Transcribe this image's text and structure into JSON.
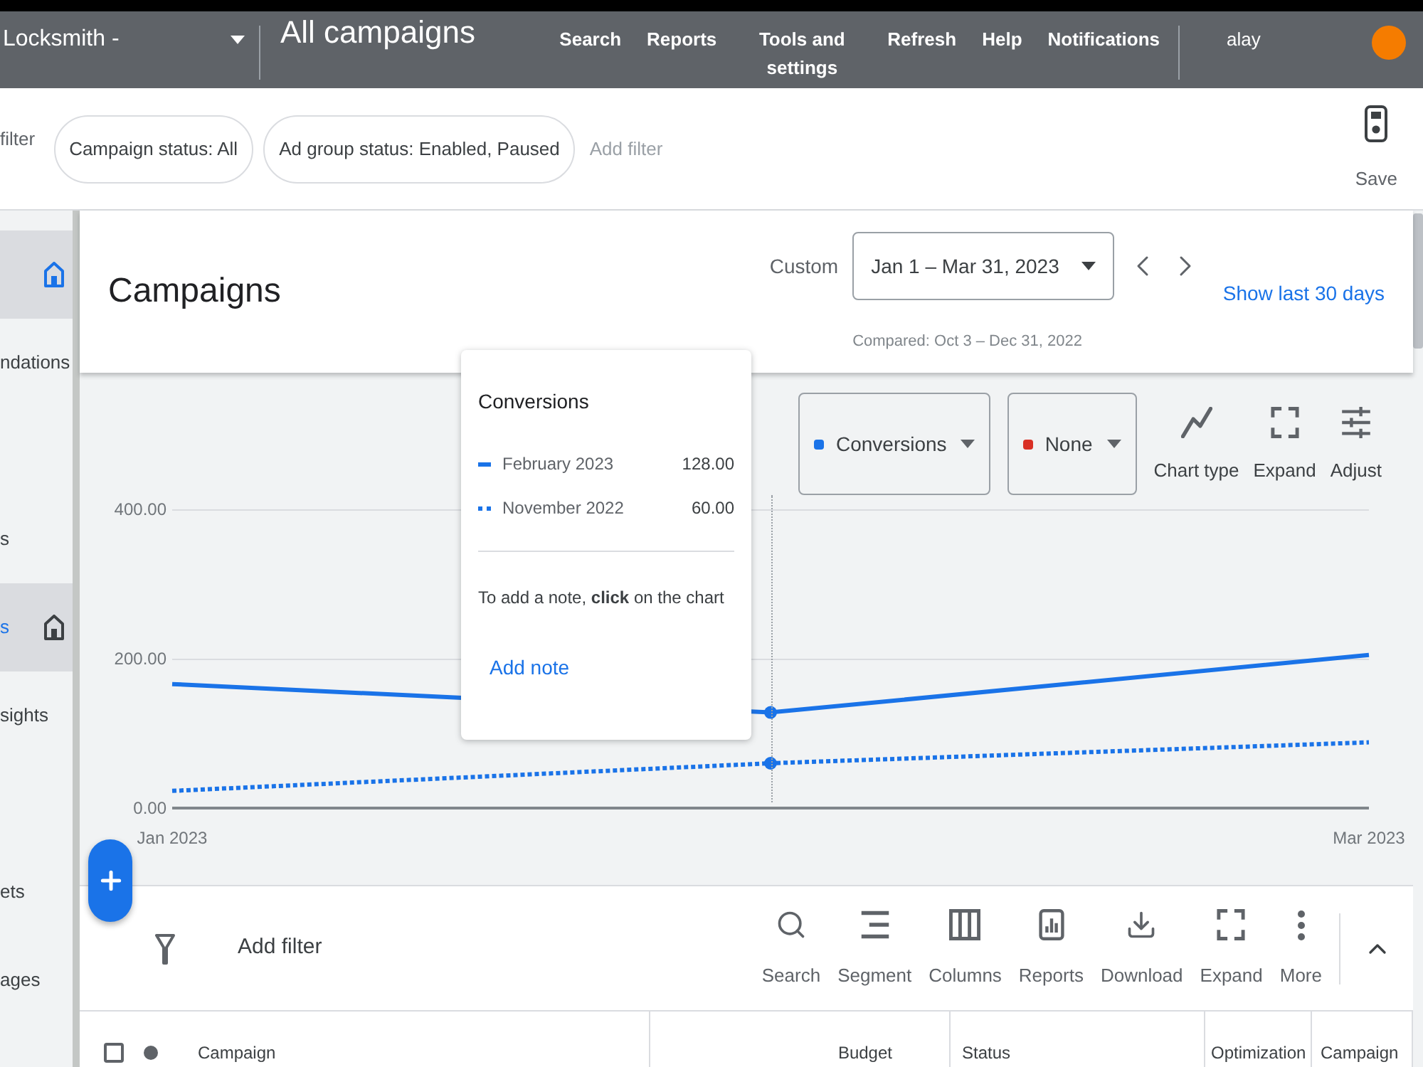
{
  "header": {
    "account": "Locksmith -",
    "page_title": "All campaigns",
    "nav": [
      "Search",
      "Reports",
      "Tools and settings",
      "Refresh",
      "Help",
      "Notifications"
    ],
    "user": "alay"
  },
  "filter_bar": {
    "leading_text": "filter",
    "chips": [
      "Campaign status: All",
      "Ad group status: Enabled, Paused"
    ],
    "add_filter": "Add filter",
    "save": "Save"
  },
  "sidebar": {
    "sections": [
      {
        "items": [
          {
            "selected": true,
            "home_icon": {
              "active": true
            }
          },
          {
            "label": "ndations",
            "selected": false
          }
        ]
      },
      {
        "items": [
          {
            "label": "s",
            "selected": false
          },
          {
            "label": "s",
            "selected": true,
            "home_icon": {
              "active": false
            }
          },
          {
            "label": "sights",
            "selected": false
          }
        ]
      },
      {
        "items": [
          {
            "label": "ets",
            "selected": false
          },
          {
            "label": "ages",
            "selected": false
          }
        ]
      }
    ]
  },
  "campaigns_header": {
    "title": "Campaigns",
    "range_label": "Custom",
    "date_range": "Jan 1 – Mar 31, 2023",
    "compared": "Compared: Oct 3 – Dec 31, 2022",
    "show_last": "Show last 30 days"
  },
  "chart": {
    "metrics": [
      {
        "label": "Conversions",
        "color": "#1a73e8"
      },
      {
        "label": "None",
        "color": "#d93025"
      }
    ],
    "tools": [
      {
        "label": "Chart type",
        "kind": "linechart"
      },
      {
        "label": "Expand",
        "kind": "expand"
      },
      {
        "label": "Adjust",
        "kind": "adjust"
      }
    ],
    "chart_data": {
      "type": "line",
      "categories": [
        "Jan 2023",
        null,
        "Mar 2023"
      ],
      "ylim": [
        0,
        400
      ],
      "yticks": [
        {
          "value": 0,
          "label": "0.00"
        },
        {
          "value": 200,
          "label": "200.00"
        },
        {
          "value": 400,
          "label": "400.00"
        }
      ],
      "series": [
        {
          "color": "#1a73e8",
          "line_style": "solid",
          "values": [
            166,
            128,
            205
          ]
        },
        {
          "color": "#1a73e8",
          "line_style": "dotted",
          "values": [
            23,
            60,
            88
          ]
        }
      ]
    },
    "hovered": [
      false,
      true,
      false
    ],
    "tooltip": {
      "title": "Conversions",
      "rows": [
        {
          "label": "February 2023",
          "value": "128.00",
          "kind": "solid"
        },
        {
          "label": "November 2022",
          "value": "60.00",
          "kind": "dotted"
        }
      ],
      "hint": "To add a note, **click** on the chart",
      "action": "Add note"
    }
  },
  "table_toolbar": {
    "add_filter": "Add filter",
    "tools": [
      {
        "label": "Search",
        "kind": "search"
      },
      {
        "label": "Segment",
        "kind": "segment"
      },
      {
        "label": "Columns",
        "kind": "columns"
      },
      {
        "label": "Reports",
        "kind": "reports"
      },
      {
        "label": "Download",
        "kind": "download"
      },
      {
        "label": "Expand",
        "kind": "expand"
      },
      {
        "label": "More",
        "kind": "more"
      }
    ]
  },
  "table": {
    "select_all": {
      "checked": false
    },
    "columns": [
      "Campaign",
      "Budget",
      "Status",
      "Optimization",
      "Campaign"
    ]
  }
}
